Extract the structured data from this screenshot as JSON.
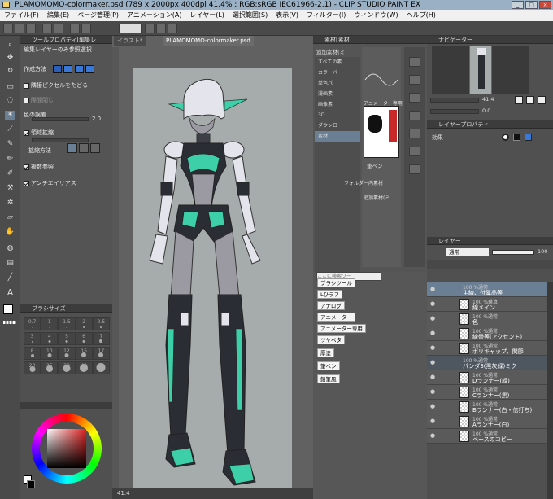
{
  "titlebar": {
    "title": "PLAMOMOMO-colormaker.psd (789 x 2000px 400dpi 41.4% : RGB:sRGB IEC61966-2.1) - CLIP STUDIO PAINT EX"
  },
  "menu": [
    "ファイル(F)",
    "編集(E)",
    "ページ管理(P)",
    "アニメーション(A)",
    "レイヤー(L)",
    "選択範囲(S)",
    "表示(V)",
    "フィルター(I)",
    "ウィンドウ(W)",
    "ヘルプ(H)"
  ],
  "tool_property": {
    "header": "ツールプロパティ[編集レ",
    "subtool": "編集レイヤーのみ参照選択",
    "mode_label": "作成方法",
    "option1": "隣接ピクセルをたどる",
    "option2": "隙間閉じ",
    "tolerance_label": "色の誤差",
    "tolerance_value": "2.0",
    "expand_label": "領域拡縮",
    "expand_method_label": "拡縮方法",
    "multi_ref_label": "複数参照",
    "antialias_label": "アンチエイリアス"
  },
  "brush_size": {
    "header": "ブラシサイズ",
    "sizes": [
      "0.7",
      "1",
      "1.5",
      "2",
      "2.5",
      "3",
      "4",
      "5",
      "6",
      "7",
      "8",
      "10",
      "12",
      "15",
      "17",
      "20",
      "25",
      "30",
      "40",
      "50"
    ]
  },
  "canvas": {
    "tab_inactive": "イラスト*",
    "tab_active": "PLAMOMOMO-colormaker.psd",
    "zoom": "41.4",
    "bg_color": "#a6abab"
  },
  "material": {
    "header": "素材[素材]",
    "top_label": "追加素材(ミ",
    "tree": [
      "すべての素",
      "カラーパ",
      "単色パ",
      "漫画素",
      "画像素",
      "3D",
      "ダウンロ",
      "素材"
    ],
    "items": [
      "アニメーター専用",
      "筆ペン",
      "フォルダー内素材",
      "追加素材(ミ"
    ]
  },
  "search": {
    "placeholder": "ここに検索ワー",
    "tags": [
      "ブラシツール",
      "Lひラフ",
      "アナログ",
      "アニメーター",
      "アニメーター専用",
      "ツヤベタ",
      "厚塗",
      "筆ペン",
      "鉛筆風"
    ]
  },
  "navigator": {
    "header": "ナビゲーター",
    "zoom": "41.4",
    "angle": "0.0"
  },
  "layer_property": {
    "header": "レイヤープロパティ",
    "effect_label": "効果"
  },
  "layers": {
    "header": "レイヤー",
    "blend_mode": "通常",
    "opacity": "100",
    "rows": [
      {
        "type": "folder",
        "sub": "100 %通常",
        "name": "主線、付属品等",
        "selected": true
      },
      {
        "type": "layer",
        "sub": "100 %乗算",
        "name": "線メイン"
      },
      {
        "type": "layer",
        "sub": "100 %通常",
        "name": "色"
      },
      {
        "type": "layer",
        "sub": "100 %通常",
        "name": "線骨等(アクセント)"
      },
      {
        "type": "layer",
        "sub": "100 %通常",
        "name": "ポリキャップ、関節"
      },
      {
        "type": "folder",
        "sub": "100 %通常",
        "name": "パンダ3(黒灰緑)ミク"
      },
      {
        "type": "layer",
        "sub": "100 %通常",
        "name": "Dランナー(緑)"
      },
      {
        "type": "layer",
        "sub": "100 %通常",
        "name": "Cランナー(黒)"
      },
      {
        "type": "layer",
        "sub": "100 %通常",
        "name": "Bランナー(白・信打ち)"
      },
      {
        "type": "layer",
        "sub": "100 %通常",
        "name": "Aランナー(白)"
      },
      {
        "type": "layer",
        "sub": "100 %通常",
        "name": "ベースのコピー"
      }
    ]
  },
  "colors": {
    "accent": "#3dd0a8",
    "dark": "#2a2d33",
    "light": "#e4e5ec",
    "selection": "#6b7f94"
  }
}
